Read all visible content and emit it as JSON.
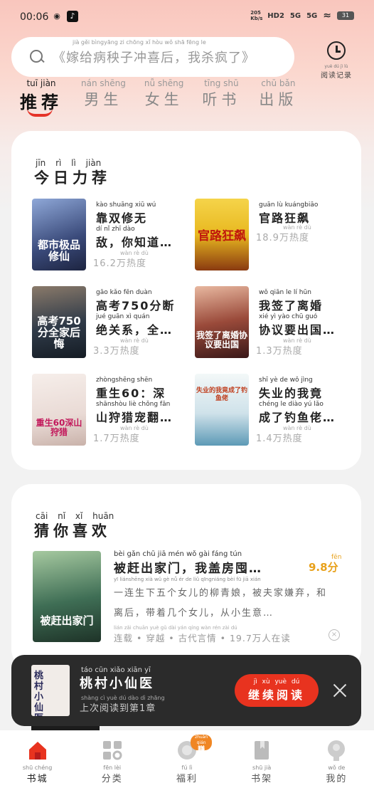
{
  "status_bar": {
    "time": "00:06",
    "app_icons": [
      "wechat-icon",
      "tiktok-icon"
    ],
    "speed": "205 Kb/s",
    "hd": "HD2",
    "sig1": "5G",
    "sig2": "5G",
    "battery": "31"
  },
  "search": {
    "placeholder": "《嫁给病秧子冲喜后，我杀疯了》",
    "placeholder_pinyin": "jià gěi bìngyāng zi chōng xǐ hòu  wǒ shā fēng le"
  },
  "history": {
    "label": "阅读记录",
    "pinyin": "yuè dú jì lù"
  },
  "tabs": [
    {
      "label": "推荐",
      "pinyin": "tuī jiàn",
      "active": true
    },
    {
      "label": "男生",
      "pinyin": "nán shēng",
      "active": false
    },
    {
      "label": "女生",
      "pinyin": "nǚ shēng",
      "active": false
    },
    {
      "label": "听书",
      "pinyin": "tīng shū",
      "active": false
    },
    {
      "label": "出版",
      "pinyin": "chū bǎn",
      "active": false
    }
  ],
  "today": {
    "title": "今日力荐",
    "pinyin": "jīn rì lì jiàn",
    "books": [
      {
        "cover_text": "都市极品修仙",
        "cover_color": "#3a4a7a",
        "line1_py": "kào shuāng xiū wú",
        "line1": "靠双修无",
        "line2_py": "dí   nǐ zhī dào",
        "line2": "敌，你知道…",
        "heat_py": "wàn rè dù",
        "heat": "16.2万热度"
      },
      {
        "cover_text": "官路狂飙",
        "cover_color": "#e8b820",
        "line1_py": "guān lù kuángbiāo",
        "line1": "官路狂飙",
        "line2_py": "",
        "line2": "",
        "heat_py": "wàn rè dù",
        "heat": "18.9万热度"
      },
      {
        "cover_text": "高考750分全家后悔",
        "cover_color": "#2f3a48",
        "line1_py": "gāo kǎo     fēn duàn",
        "line1": "高考750分断",
        "line2_py": "jué guān xì   quán",
        "line2": "绝关系，全…",
        "heat_py": "wàn rè dù",
        "heat": "3.3万热度"
      },
      {
        "cover_text": "我签了离婚协议要出国",
        "cover_color": "#5a3030",
        "line1_py": "wǒ qiān le  lí hūn",
        "line1": "我签了离婚",
        "line2_py": "xié yì yào chū guó",
        "line2": "协议要出国…",
        "heat_py": "wàn rè dù",
        "heat": "1.3万热度"
      },
      {
        "cover_text": "重生60深山狩猎",
        "cover_color": "#e9dad5",
        "line1_py": "zhòngshēng     shēn",
        "line1": "重生60：深",
        "line2_py": "shānshòu liè chǒng fān",
        "line2": "山狩猎宠翻…",
        "heat_py": "wàn rè dù",
        "heat": "1.7万热度"
      },
      {
        "cover_text": "失业的我竟成了钓鱼佬",
        "cover_color": "#cfe2ea",
        "line1_py": "shī yè de wǒ jìng",
        "line1": "失业的我竟",
        "line2_py": "chéng le diào yú lǎo",
        "line2": "成了钓鱼佬…",
        "heat_py": "wàn rè dù",
        "heat": "1.4万热度"
      }
    ]
  },
  "guess": {
    "title": "猜你喜欢",
    "pinyin": "cāi nǐ xǐ huān",
    "book": {
      "cover_text": "被赶出家门",
      "title_py": "bèi gǎn chū jiā mén   wǒ gài fáng tún",
      "title": "被赶出家门，我盖房囤…",
      "score_py": "fēn",
      "score": "9.8分",
      "desc_py1": "yī liánshēng xià wǔ gè nǚ ér de liǔ qīngniáng   bèi fū jiā xián",
      "desc": "一连生下五个女儿的柳青娘，被夫家嫌弃，和离后，带着几个女儿，从小生意…",
      "meta": "连载 • 穿越 • 古代言情 • 19.7万人在读",
      "meta_py": "lián zǎi  chuān yuè  gǔ dài yán qíng  wàn rén zài dú"
    }
  },
  "continue_reading": {
    "title": "桃村小仙医",
    "title_py": "táo cūn xiǎo xiān yī",
    "sub": "上次阅读到第1章",
    "sub_py": "shàng cì yuè dú dào dì  zhāng",
    "button": "继续阅读",
    "button_py": "jì xù yuè dú",
    "cover_text": "桃村小仙医"
  },
  "bottom_nav": [
    {
      "label": "书城",
      "pinyin": "shū chéng",
      "icon": "house-icon",
      "active": true
    },
    {
      "label": "分类",
      "pinyin": "fēn lèi",
      "icon": "category-icon",
      "active": false
    },
    {
      "label": "福利",
      "pinyin": "fú lì",
      "icon": "gift-icon",
      "active": false,
      "badge": "赚钱",
      "badge_py": "zhuàn qián"
    },
    {
      "label": "书架",
      "pinyin": "shū jià",
      "icon": "bookshelf-icon",
      "active": false
    },
    {
      "label": "我的",
      "pinyin": "wǒ de",
      "icon": "profile-icon",
      "active": false
    }
  ],
  "colors": {
    "accent": "#e8331f",
    "score": "#e8a11b",
    "dark_bar": "#2b2b2b"
  }
}
